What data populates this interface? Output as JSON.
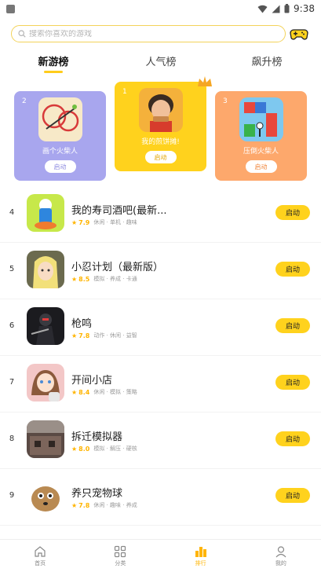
{
  "status_bar": {
    "time": "9:38"
  },
  "search": {
    "placeholder": "搜索你喜欢的游戏"
  },
  "tabs": [
    {
      "label": "新游榜",
      "active": true
    },
    {
      "label": "人气榜",
      "active": false
    },
    {
      "label": "飙升榜",
      "active": false
    }
  ],
  "podium": [
    {
      "rank": "2",
      "name": "画个火柴人",
      "button": "启动"
    },
    {
      "rank": "1",
      "name": "我的煎饼摊!",
      "button": "启动"
    },
    {
      "rank": "3",
      "name": "压倒火柴人",
      "button": "启动"
    }
  ],
  "list": [
    {
      "index": "4",
      "name": "我的寿司酒吧(最新...",
      "score": "7.9",
      "tags": "休闲 · 单机 · 趣味",
      "button": "启动"
    },
    {
      "index": "5",
      "name": "小忍计划（最新版）",
      "score": "8.5",
      "tags": "模拟 · 养成 · 卡通",
      "button": "启动"
    },
    {
      "index": "6",
      "name": "枪鸣",
      "score": "7.8",
      "tags": "动作 · 休闲 · 益智",
      "button": "启动"
    },
    {
      "index": "7",
      "name": "开间小店",
      "score": "8.4",
      "tags": "休闲 · 模拟 · 策略",
      "button": "启动"
    },
    {
      "index": "8",
      "name": "拆迁模拟器",
      "score": "8.0",
      "tags": "模拟 · 解压 · 硬核",
      "button": "启动"
    },
    {
      "index": "9",
      "name": "养只宠物球",
      "score": "7.8",
      "tags": "休闲 · 趣味 · 养成",
      "button": "启动"
    }
  ],
  "bottom_nav": [
    {
      "label": "首页",
      "icon": "home-icon",
      "active": false
    },
    {
      "label": "分类",
      "icon": "grid-icon",
      "active": false
    },
    {
      "label": "排行",
      "icon": "ranking-icon",
      "active": true
    },
    {
      "label": "我的",
      "icon": "user-icon",
      "active": false
    }
  ],
  "colors": {
    "accent": "#ffd21d",
    "card2": "#a8a6ee",
    "card1": "#ffd21d",
    "card3": "#fda86c"
  }
}
